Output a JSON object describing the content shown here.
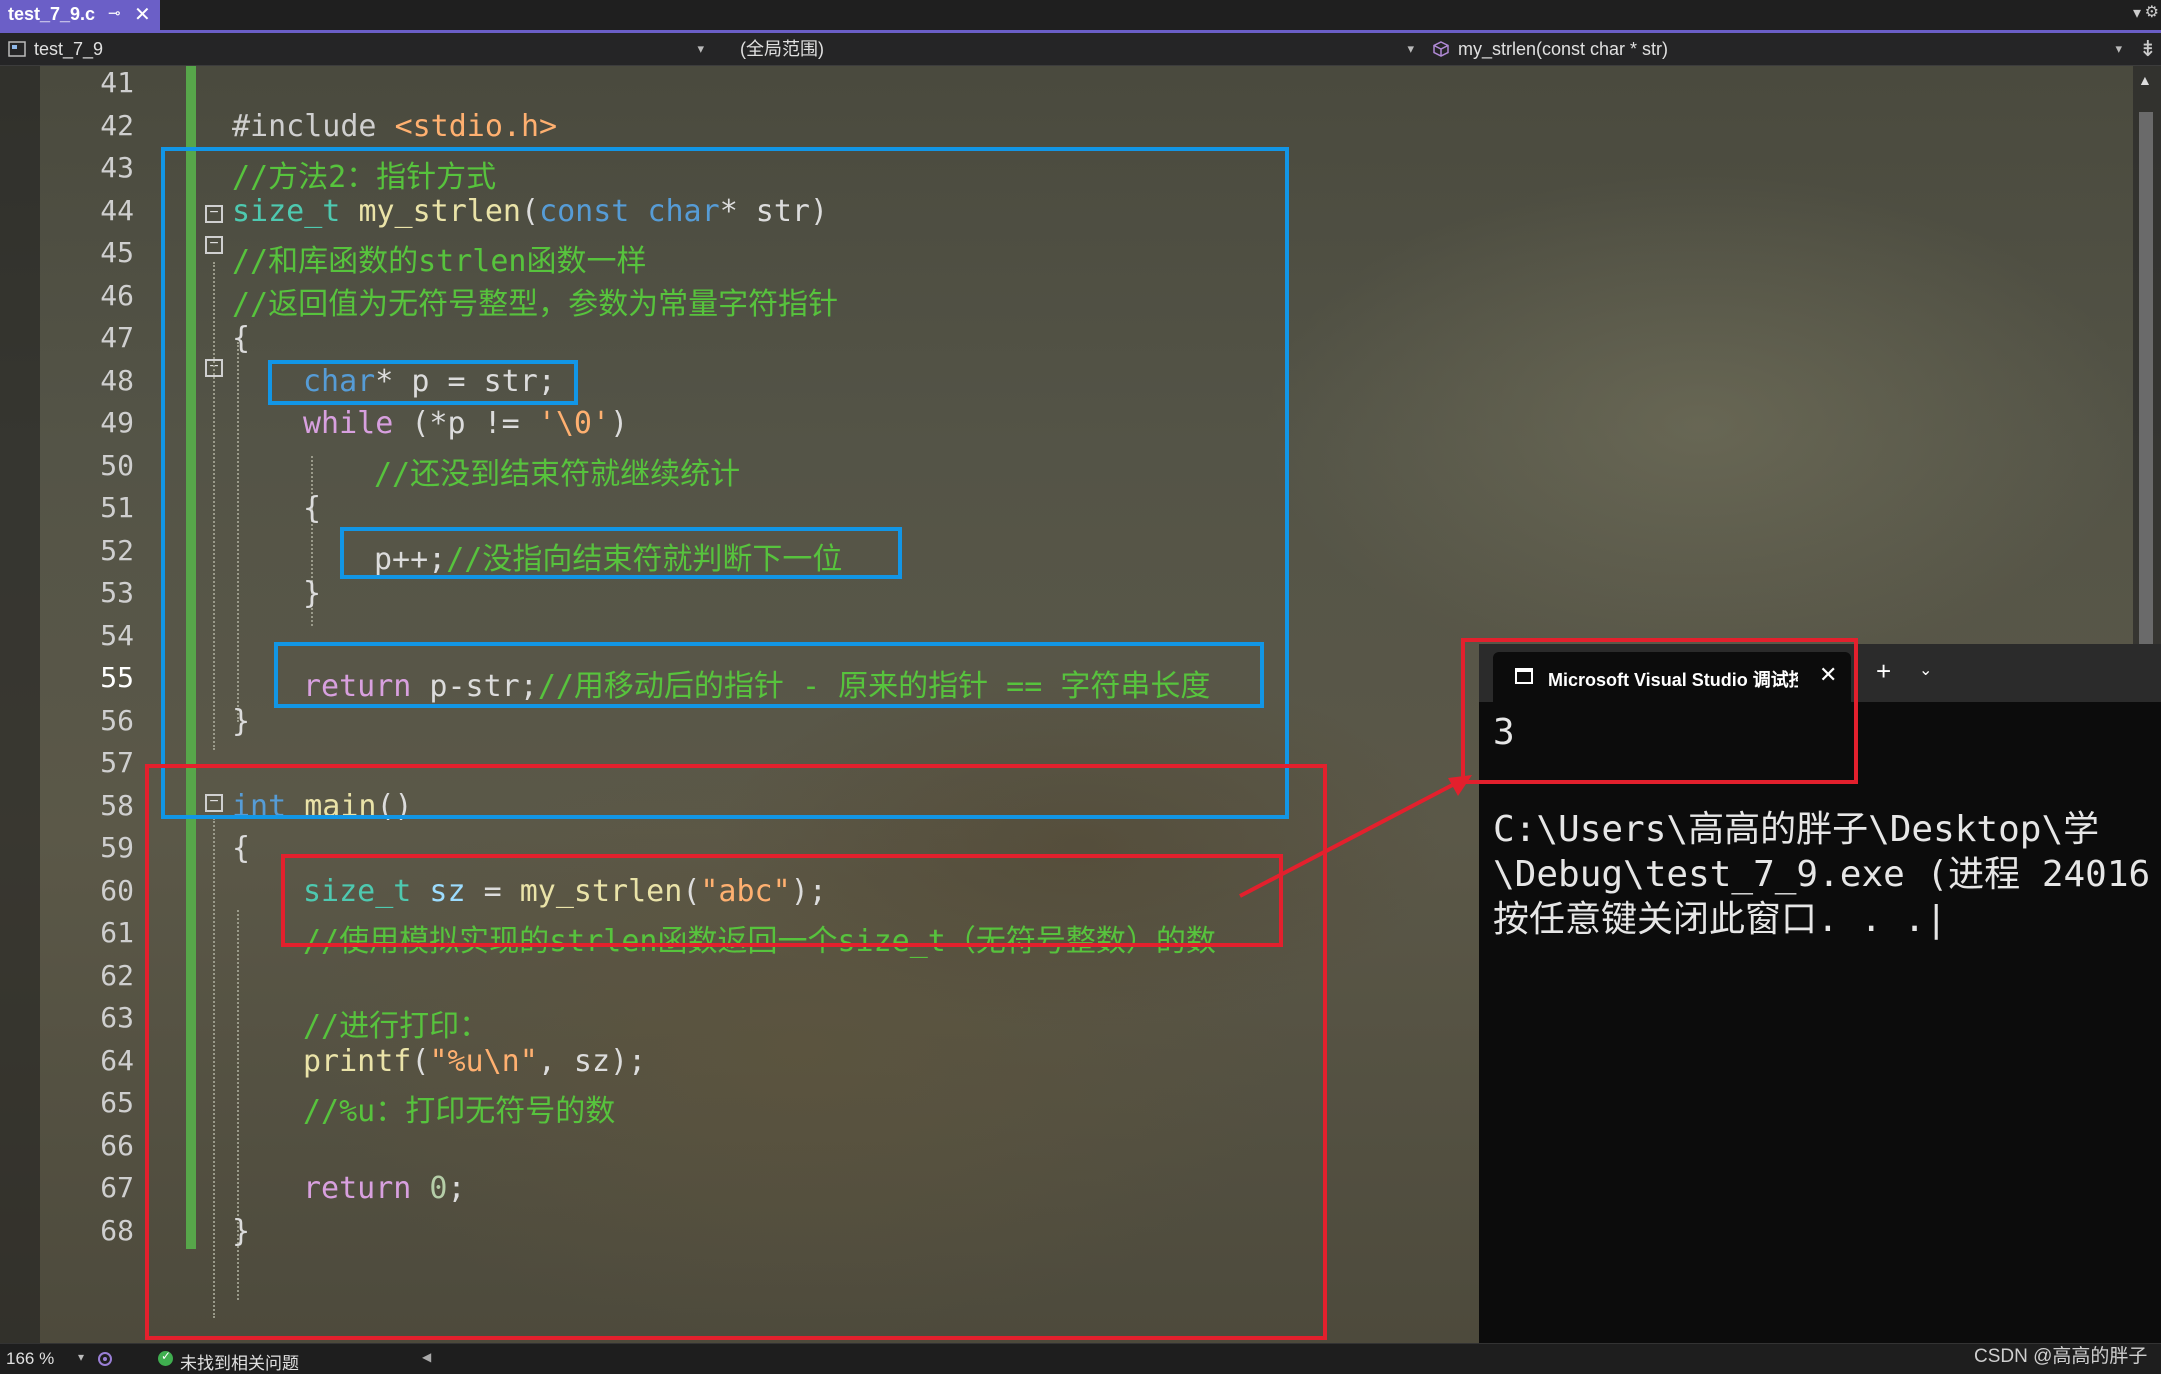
{
  "tab": {
    "title": "test_7_9.c",
    "pin": "⊸",
    "close": "✕"
  },
  "navbar": {
    "project": "test_7_9",
    "scope": "(全局范围)",
    "member": "my_strlen(const char * str)"
  },
  "editor": {
    "lines": [
      {
        "n": "41"
      },
      {
        "n": "42"
      },
      {
        "n": "43"
      },
      {
        "n": "44"
      },
      {
        "n": "45"
      },
      {
        "n": "46"
      },
      {
        "n": "47"
      },
      {
        "n": "48"
      },
      {
        "n": "49"
      },
      {
        "n": "50"
      },
      {
        "n": "51"
      },
      {
        "n": "52"
      },
      {
        "n": "53"
      },
      {
        "n": "54"
      },
      {
        "n": "55",
        "current": true
      },
      {
        "n": "56"
      },
      {
        "n": "57"
      },
      {
        "n": "58"
      },
      {
        "n": "59"
      },
      {
        "n": "60"
      },
      {
        "n": "61"
      },
      {
        "n": "62"
      },
      {
        "n": "63"
      },
      {
        "n": "64"
      },
      {
        "n": "65"
      },
      {
        "n": "66"
      },
      {
        "n": "67"
      },
      {
        "n": "68"
      }
    ],
    "code": {
      "l42_inc": "#include ",
      "l42_hdr": "<stdio.h>",
      "l43": "//方法2：指针方式",
      "l44_type": "size_t",
      "l44_fn": "my_strlen",
      "l44_open": "(",
      "l44_kw1": "const",
      "l44_kw2": "char",
      "l44_rest": "* str)",
      "l45": "//和库函数的strlen函数一样",
      "l46": "//返回值为无符号整型，参数为常量字符指针",
      "l47": "{",
      "l48_kw": "char",
      "l48_rest": "* p = str;",
      "l49_kw": "while",
      "l49_a": " (*p != ",
      "l49_chr": "'\\0'",
      "l49_b": ")",
      "l50": "//还没到结束符就继续统计",
      "l51": "{",
      "l52_code": "p++;",
      "l52_cmt": "//没指向结束符就判断下一位",
      "l53": "}",
      "l55_kw": "return",
      "l55_code": " p-str;",
      "l55_cmt": "//用移动后的指针 - 原来的指针 == 字符串长度",
      "l56": "}",
      "l58_kw": "int",
      "l58_fn": " main",
      "l58_rest": "()",
      "l59": "{",
      "l60_type": "size_t",
      "l60_var": " sz",
      "l60_eq": " = ",
      "l60_fn": "my_strlen",
      "l60_open": "(",
      "l60_str": "\"abc\"",
      "l60_close": ");",
      "l61": "//使用模拟实现的strlen函数返回一个size_t（无符号整数）的数",
      "l63": "//进行打印：",
      "l64_fn": "printf",
      "l64_open": "(",
      "l64_str": "\"%u\\n\"",
      "l64_rest": ", sz);",
      "l65": "//%u：打印无符号的数",
      "l67_kw": "return",
      "l67_num": " 0",
      "l67_end": ";",
      "l68": "}"
    }
  },
  "console": {
    "tab_title": "Microsoft Visual Studio 调试控",
    "close": "✕",
    "new_tab": "+",
    "dropdown": "⌄",
    "output_value": "3",
    "line1": "C:\\Users\\高高的胖子\\Desktop\\学",
    "line2": "\\Debug\\test_7_9.exe (进程 24016",
    "line3": "按任意键关闭此窗口. . .|"
  },
  "statusbar": {
    "zoom": "166 %",
    "issues": "未找到相关问题"
  },
  "watermark": "CSDN @高高的胖子",
  "colors": {
    "accent": "#6b5fc7",
    "annotation_blue": "#1296e6",
    "annotation_red": "#e3202d",
    "change_bar": "#57a64a"
  }
}
